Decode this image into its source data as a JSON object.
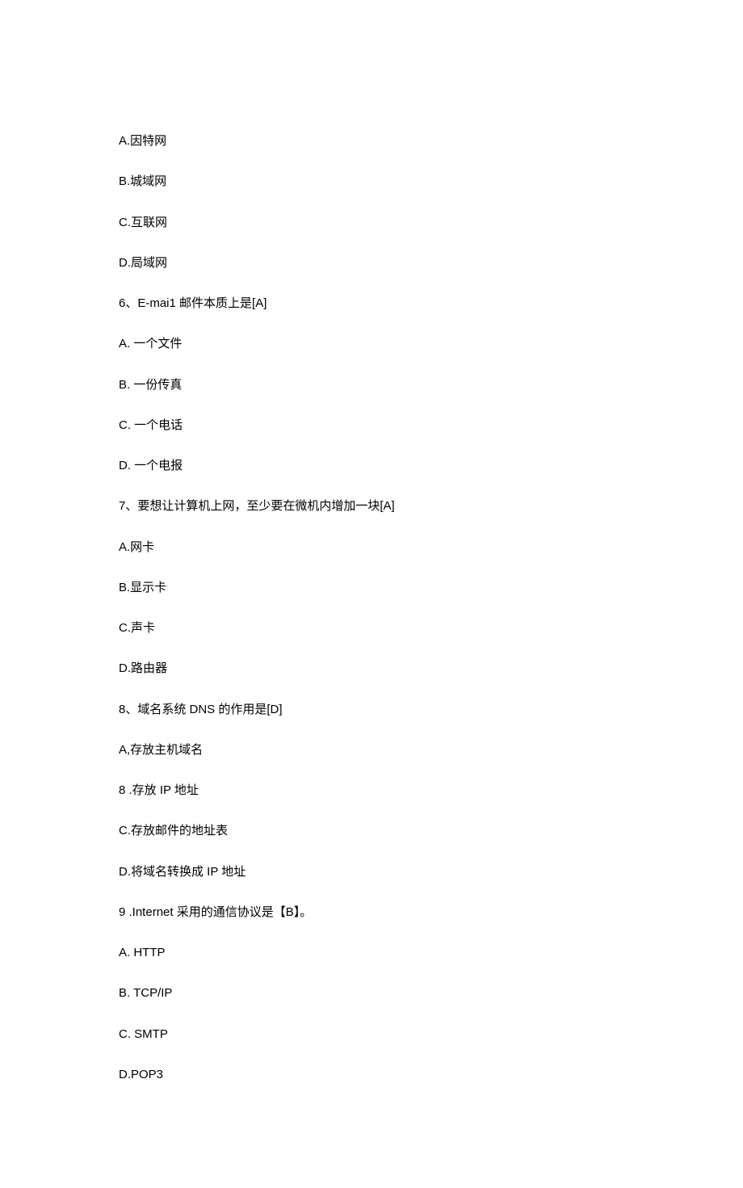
{
  "lines": [
    "A.因特网",
    "B.城域网",
    "C.互联网",
    "D.局域网",
    "6、E-mai1 邮件本质上是[A]",
    "A.   一个文件",
    "B.   一份传真",
    "C.   一个电话",
    "D.   一个电报",
    "7、要想让计算机上网，至少要在微机内增加一块[A]",
    "A.网卡",
    "B.显示卡",
    "C.声卡",
    "D.路由器",
    "8、域名系统 DNS 的作用是[D]",
    "A,存放主机域名",
    "8   .存放 IP 地址",
    "C.存放邮件的地址表",
    "D.将域名转换成 IP 地址",
    "9   .Internet 采用的通信协议是【B】。",
    "A.   HTTP",
    "B.   TCP/IP",
    "C.   SMTP",
    "D.POP3"
  ]
}
